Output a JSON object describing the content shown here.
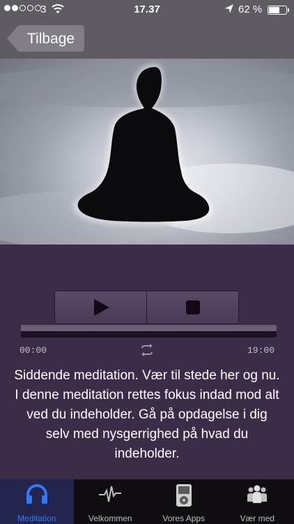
{
  "status_bar": {
    "carrier": "3",
    "time": "17.37",
    "battery_percent": "62 %",
    "battery_level": 0.62,
    "signal_bars_filled": 2,
    "signal_bars_total": 5
  },
  "nav": {
    "back_label": "Tilbage"
  },
  "player": {
    "time_start": "00:00",
    "time_end": "19:00",
    "progress": 0.0,
    "description": "Siddende meditation. Vær til stede her og nu.\nI denne meditation rettes fokus indad mod alt ved du indeholder. Gå på opdagelse i dig selv med nysgerrighed på hvad du indeholder."
  },
  "tabs": [
    {
      "label": "Meditation",
      "icon": "headphones-icon",
      "active": true
    },
    {
      "label": "Velkommen",
      "icon": "pulse-icon",
      "active": false
    },
    {
      "label": "Vores Apps",
      "icon": "music-player-icon",
      "active": false
    },
    {
      "label": "Vær med",
      "icon": "people-icon",
      "active": false
    }
  ],
  "colors": {
    "accent": "#2f7bf5",
    "player_bg": "#3b2c48",
    "nav_bg": "#5e5b62"
  }
}
